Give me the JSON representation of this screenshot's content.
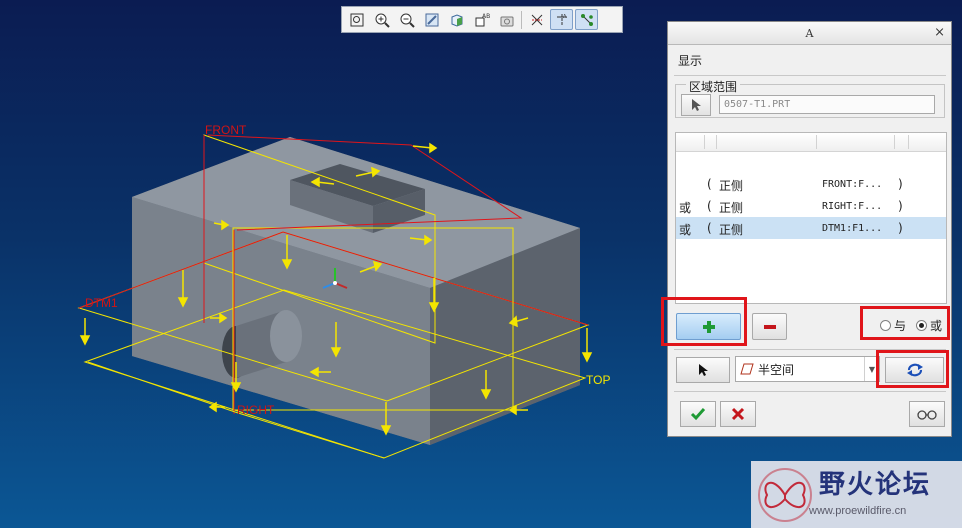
{
  "model_view": {
    "plane_labels": {
      "front": "FRONT",
      "dtm1": "DTM1",
      "right": "RIGHT",
      "top": "TOP"
    }
  },
  "toolbar": {
    "icons": [
      "zoom-fit-icon",
      "zoom-in-icon",
      "zoom-out-icon",
      "repaint-icon",
      "display-style-icon",
      "named-views-icon",
      "view-manager-icon",
      "datum-planes-icon",
      "datum-axes-icon",
      "datum-points-icon"
    ]
  },
  "dialog": {
    "title": "A",
    "close_label": "×",
    "heading": "显示",
    "region_group_title": "区域范围",
    "region_value": "0507-T1.PRT",
    "rows": [
      {
        "op": "",
        "lparen": "(",
        "side": "正侧",
        "ref": "FRONT:F...",
        "rparen": ")"
      },
      {
        "op": "或",
        "lparen": "(",
        "side": "正侧",
        "ref": "RIGHT:F...",
        "rparen": ")"
      },
      {
        "op": "或",
        "lparen": "(",
        "side": "正侧",
        "ref": "DTM1:F1...",
        "rparen": ")"
      }
    ],
    "selected_row": 2,
    "and_label": "与",
    "or_label": "或",
    "logic_selected": "or",
    "type_value": "半空间"
  },
  "colors": {
    "accent_green": "#1f9a35",
    "accent_red": "#c4161c",
    "highlight_red": "#e0151a",
    "datum_yellow": "#f4e500",
    "datum_label_red": "#d11414"
  },
  "watermark": {
    "title": "野火论坛",
    "url": "www.proewildfire.cn"
  }
}
